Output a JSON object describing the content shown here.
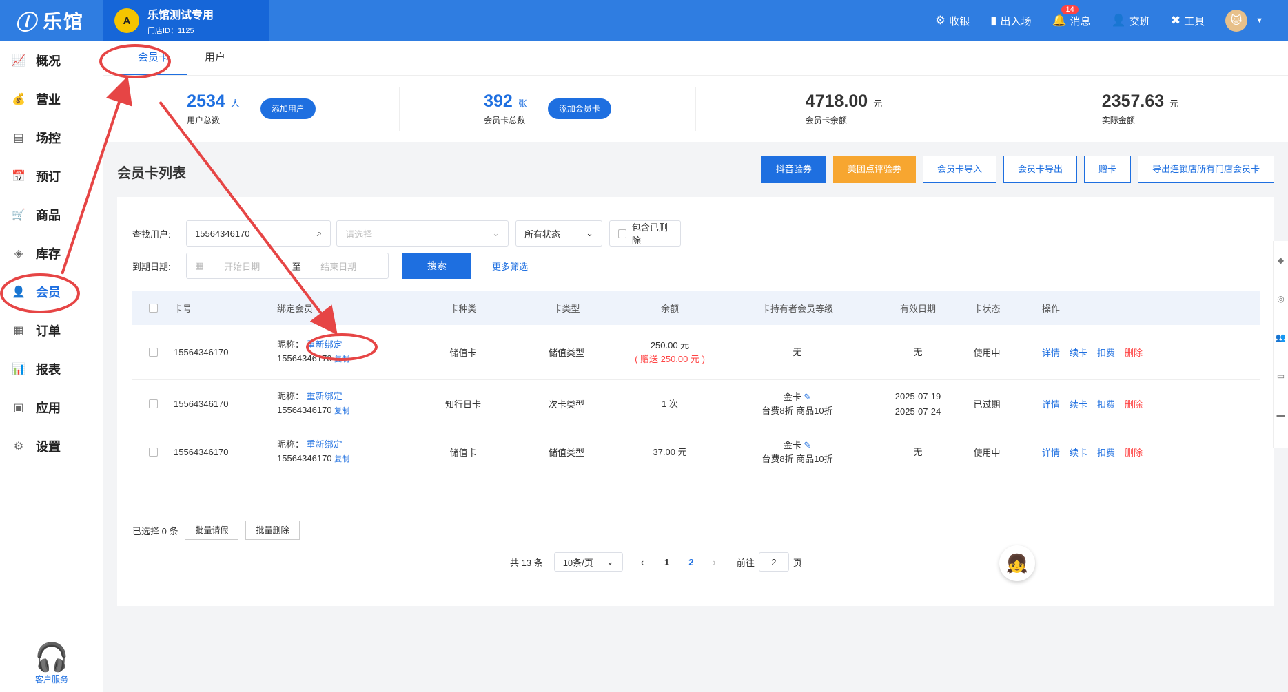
{
  "brand": {
    "logo_text": "乐馆",
    "store_name": "乐馆测试专用",
    "store_id": "门店ID：1125",
    "store_badge": "A"
  },
  "top_tools": [
    {
      "name": "cashier",
      "label": "收银",
      "icon": "cashier-icon"
    },
    {
      "name": "entry-exit",
      "label": "出入场",
      "icon": "door-icon"
    },
    {
      "name": "messages",
      "label": "消息",
      "icon": "bell-icon",
      "badge": "14"
    },
    {
      "name": "shift",
      "label": "交班",
      "icon": "user-swap-icon"
    },
    {
      "name": "tools",
      "label": "工具",
      "icon": "wrench-icon"
    }
  ],
  "sidebar": {
    "items": [
      {
        "key": "overview",
        "label": "概况",
        "glyph": "📈"
      },
      {
        "key": "business",
        "label": "营业",
        "glyph": "💰"
      },
      {
        "key": "venue",
        "label": "场控",
        "glyph": "▤"
      },
      {
        "key": "booking",
        "label": "预订",
        "glyph": "📅"
      },
      {
        "key": "goods",
        "label": "商品",
        "glyph": "🛒"
      },
      {
        "key": "stock",
        "label": "库存",
        "glyph": "◈"
      },
      {
        "key": "member",
        "label": "会员",
        "glyph": "👤",
        "active": true
      },
      {
        "key": "orders",
        "label": "订单",
        "glyph": "▦"
      },
      {
        "key": "reports",
        "label": "报表",
        "glyph": "📊"
      },
      {
        "key": "apps",
        "label": "应用",
        "glyph": "▣"
      },
      {
        "key": "settings",
        "label": "设置",
        "glyph": "⚙"
      }
    ],
    "service_label": "客户服务"
  },
  "tabs": [
    {
      "label": "会员卡",
      "active": true
    },
    {
      "label": "用户",
      "active": false
    }
  ],
  "stats": {
    "users": {
      "value": "2534",
      "unit": "人",
      "label": "用户总数",
      "button": "添加用户"
    },
    "cards": {
      "value": "392",
      "unit": "张",
      "label": "会员卡总数",
      "button": "添加会员卡"
    },
    "balance": {
      "value": "4718.00",
      "unit": "元",
      "label": "会员卡余额"
    },
    "actual": {
      "value": "2357.63",
      "unit": "元",
      "label": "实际金额"
    }
  },
  "section_title": "会员卡列表",
  "actions": [
    "抖音验券",
    "美团点评验券",
    "会员卡导入",
    "会员卡导出",
    "赠卡",
    "导出连锁店所有门店会员卡"
  ],
  "filters": {
    "search_label": "查找用户:",
    "search_value": "15564346170",
    "select_placeholder": "请选择",
    "status_value": "所有状态",
    "include_deleted": "包含已删除",
    "date_label": "到期日期:",
    "start_placeholder": "开始日期",
    "to": "至",
    "end_placeholder": "结束日期",
    "search_button": "搜索",
    "more_filters": "更多筛选"
  },
  "table": {
    "headers": [
      "卡号",
      "绑定会员",
      "卡种类",
      "卡类型",
      "余额",
      "卡持有者会员等级",
      "有效日期",
      "卡状态",
      "操作"
    ],
    "rows": [
      {
        "card_no": "15564346170",
        "nick": "昵称：",
        "rebind": "重新绑定",
        "phone": "15564346170",
        "copy": "复制",
        "kind": "储值卡",
        "type": "储值类型",
        "balance": "250.00 元",
        "gift": "( 赠送 250.00 元 )",
        "level": "无",
        "level_detail": "",
        "date1": "无",
        "date2": "",
        "status": "使用中"
      },
      {
        "card_no": "15564346170",
        "nick": "昵称：",
        "rebind": "重新绑定",
        "phone": "15564346170",
        "copy": "复制",
        "kind": "知行日卡",
        "type": "次卡类型",
        "balance": "1 次",
        "gift": "",
        "level": "金卡",
        "level_detail": "台费8折 商品10折",
        "date1": "2025-07-19",
        "date2": "2025-07-24",
        "status": "已过期"
      },
      {
        "card_no": "15564346170",
        "nick": "昵称：",
        "rebind": "重新绑定",
        "phone": "15564346170",
        "copy": "复制",
        "kind": "储值卡",
        "type": "储值类型",
        "balance": "37.00 元",
        "gift": "",
        "level": "金卡",
        "level_detail": "台费8折 商品10折",
        "date1": "无",
        "date2": "",
        "status": "使用中"
      }
    ],
    "row_actions": [
      "详情",
      "续卡",
      "扣费",
      "删除"
    ]
  },
  "bulk": {
    "selected": "已选择 0 条",
    "leave": "批量请假",
    "delete": "批量删除"
  },
  "pager": {
    "total": "共 13 条",
    "page_size": "10条/页",
    "pages": [
      "1",
      "2"
    ],
    "goto_label": "前往",
    "goto_value": "2",
    "page_unit": "页"
  }
}
